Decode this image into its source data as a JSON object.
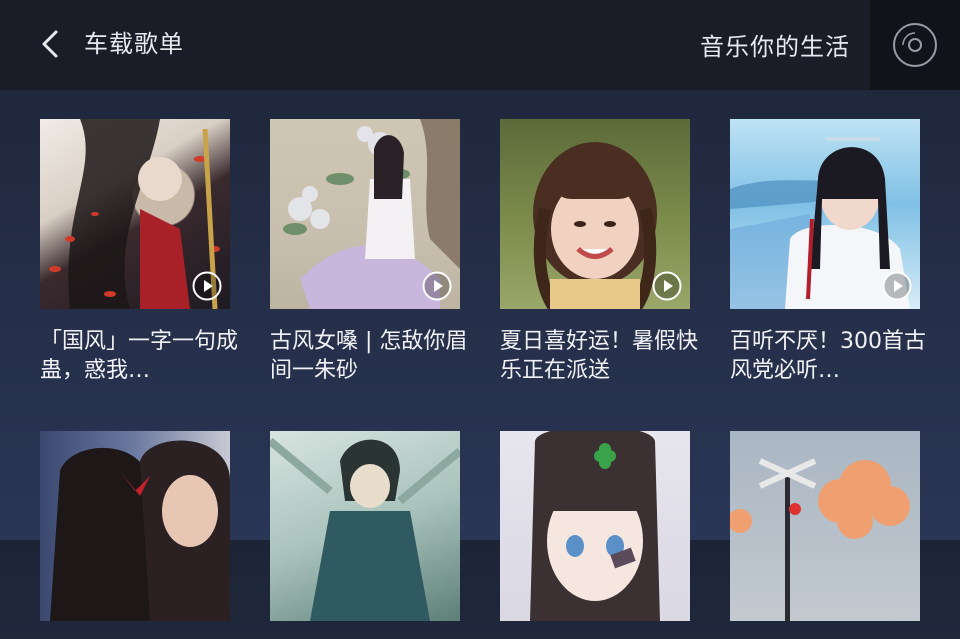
{
  "header": {
    "title": "车载歌单",
    "slogan": "音乐你的生活",
    "back_icon": "chevron-left-icon",
    "disc_icon": "disc-icon"
  },
  "playlists": [
    {
      "title": "「国风」一字一句成蛊，惑我…",
      "cover_hint": "ink-painting girl with red leaves"
    },
    {
      "title": "古风女嗓 | 怎敌你眉间一朱砂",
      "cover_hint": "ancient-style girl among flowers"
    },
    {
      "title": "夏日喜好运！暑假快乐正在派送",
      "cover_hint": "smiling girl with braids"
    },
    {
      "title": "百听不厌！300首古风党必听…",
      "cover_hint": "young man in white hanfu"
    },
    {
      "title": "",
      "cover_hint": "couple close-up"
    },
    {
      "title": "",
      "cover_hint": "anime warrior"
    },
    {
      "title": "",
      "cover_hint": "anime girl with clover hairpin"
    },
    {
      "title": "",
      "cover_hint": "railroad crossing and pink clouds"
    }
  ],
  "colors": {
    "topbar": "#1a1c27",
    "disc_button": "#11131b",
    "background_top": "#1d2436",
    "background_bottom": "#2a3656"
  }
}
